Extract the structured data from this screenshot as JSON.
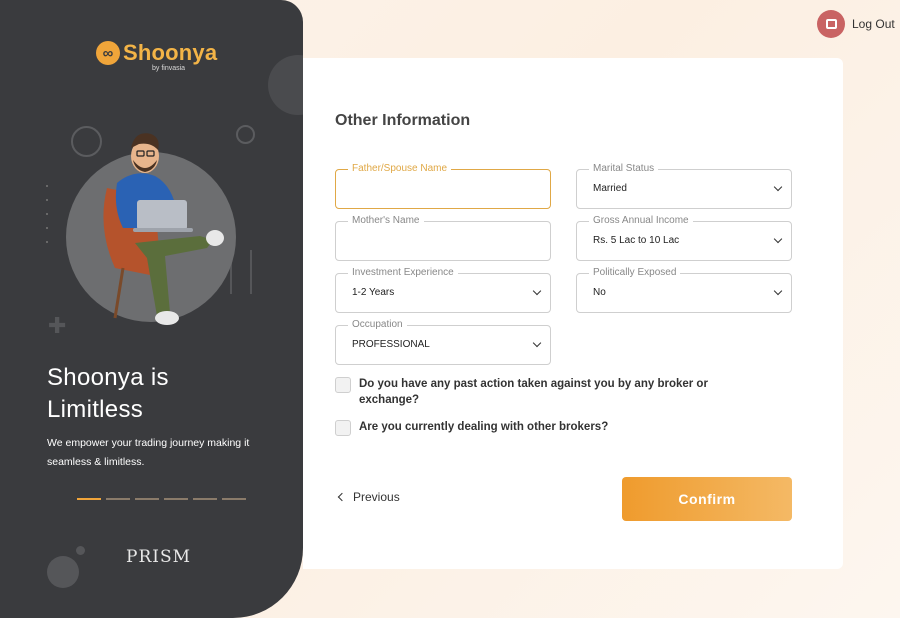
{
  "logout": {
    "label": "Log Out",
    "icon": "logout-icon"
  },
  "brand": {
    "name": "Shoonya",
    "byline": "by finvasia",
    "headline_line1": "Shoonya is",
    "headline_line2": "Limitless",
    "tagline": "We empower your trading journey making it seamless & limitless.",
    "partner": "PRISM",
    "carousel_pages": 6,
    "carousel_active": 1,
    "accent": "#f0a53a"
  },
  "form": {
    "title": "Other Information",
    "fields": {
      "father_spouse": {
        "label": "Father/Spouse Name",
        "value": ""
      },
      "marital_status": {
        "label": "Marital Status",
        "value": "Married"
      },
      "mother_name": {
        "label": "Mother's Name",
        "value": ""
      },
      "income": {
        "label": "Gross Annual Income",
        "value": "Rs. 5 Lac to 10 Lac"
      },
      "experience": {
        "label": "Investment Experience",
        "value": "1-2 Years"
      },
      "politically_exposed": {
        "label": "Politically Exposed",
        "value": "No"
      },
      "occupation": {
        "label": "Occupation",
        "value": "PROFESSIONAL"
      }
    },
    "checks": {
      "past_action": "Do you have any past action taken against you by any broker or exchange?",
      "other_brokers": "Are you currently dealing with other brokers?"
    },
    "previous_label": "Previous",
    "confirm_label": "Confirm"
  }
}
